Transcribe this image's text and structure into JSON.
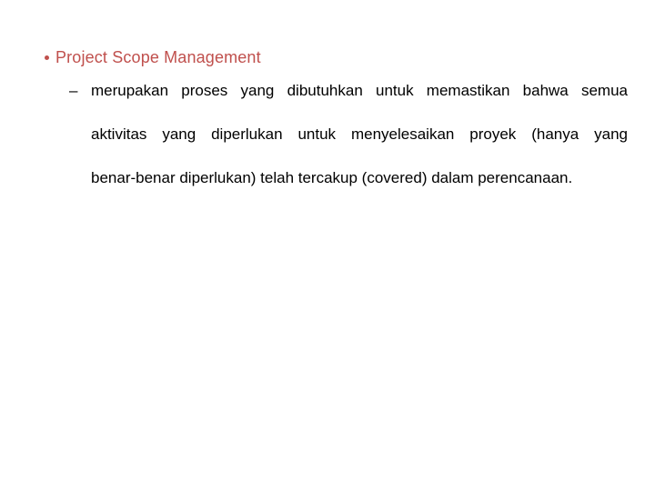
{
  "slide": {
    "background_color": "#ffffff",
    "accent_color": "#C0504D",
    "body_color": "#000000",
    "level1": {
      "bullet_glyph": "•",
      "title": "Project Scope Management"
    },
    "level2": {
      "dash_glyph": "–",
      "lines": [
        "merupakan proses yang dibutuhkan untuk memastikan bahwa semua",
        "aktivitas yang diperlukan untuk menyelesaikan proyek (hanya yang",
        "benar-benar diperlukan)  telah tercakup (covered) dalam perencanaan."
      ],
      "full_text": "merupakan proses yang dibutuhkan untuk memastikan bahwa semua aktivitas yang diperlukan untuk menyelesaikan proyek (hanya yang benar-benar diperlukan) telah tercakup (covered) dalam perencanaan."
    }
  }
}
